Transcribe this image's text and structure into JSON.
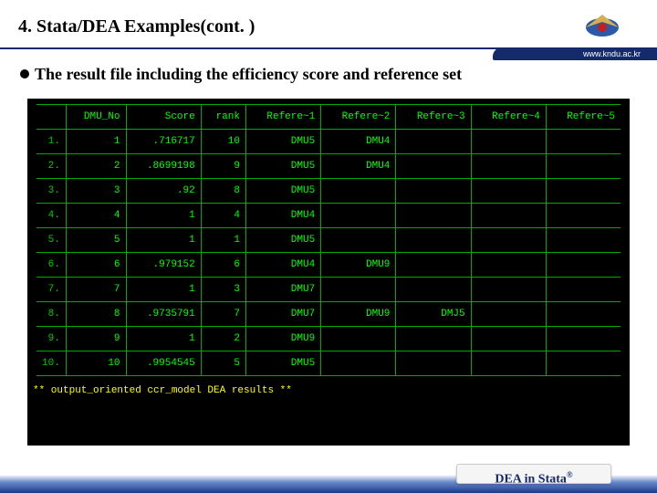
{
  "header": {
    "title": "4. Stata/DEA Examples(cont. )",
    "url": "www.kndu.ac.kr"
  },
  "bullet": "The result file including the efficiency score and reference set",
  "table": {
    "headers": [
      "",
      "DMU_No",
      "Score",
      "rank",
      "Refere~1",
      "Refere~2",
      "Refere~3",
      "Refere~4",
      "Refere~5"
    ],
    "rows": [
      [
        "1.",
        "1",
        ".716717",
        "10",
        "DMU5",
        "DMU4",
        "",
        "",
        ""
      ],
      [
        "2.",
        "2",
        ".8699198",
        "9",
        "DMU5",
        "DMU4",
        "",
        "",
        ""
      ],
      [
        "3.",
        "3",
        ".92",
        "8",
        "DMU5",
        "",
        "",
        "",
        ""
      ],
      [
        "4.",
        "4",
        "1",
        "4",
        "DMU4",
        "",
        "",
        "",
        ""
      ],
      [
        "5.",
        "5",
        "1",
        "1",
        "DMU5",
        "",
        "",
        "",
        ""
      ],
      [
        "6.",
        "6",
        ".979152",
        "6",
        "DMU4",
        "DMU9",
        "",
        "",
        ""
      ],
      [
        "7.",
        "7",
        "1",
        "3",
        "DMU7",
        "",
        "",
        "",
        ""
      ],
      [
        "8.",
        "8",
        ".9735791",
        "7",
        "DMU7",
        "DMU9",
        "DMJ5",
        "",
        ""
      ],
      [
        "9.",
        "9",
        "1",
        "2",
        "DMU9",
        "",
        "",
        "",
        ""
      ],
      [
        "10.",
        "10",
        ".9954545",
        "5",
        "DMU5",
        "",
        "",
        "",
        ""
      ]
    ],
    "message": "** output_oriented ccr_model DEA results **"
  },
  "footer": {
    "label_prefix": "DEA in Stata",
    "reg": "®"
  },
  "chart_data": {
    "type": "table",
    "title": "DEA result file: efficiency score and reference set",
    "columns": [
      "DMU_No",
      "Score",
      "rank",
      "Refere~1",
      "Refere~2",
      "Refere~3",
      "Refere~4",
      "Refere~5"
    ],
    "rows": [
      [
        1,
        0.716717,
        10,
        "DMU5",
        "DMU4",
        null,
        null,
        null
      ],
      [
        2,
        0.8699198,
        9,
        "DMU5",
        "DMU4",
        null,
        null,
        null
      ],
      [
        3,
        0.92,
        8,
        "DMU5",
        null,
        null,
        null,
        null
      ],
      [
        4,
        1,
        4,
        "DMU4",
        null,
        null,
        null,
        null
      ],
      [
        5,
        1,
        1,
        "DMU5",
        null,
        null,
        null,
        null
      ],
      [
        6,
        0.979152,
        6,
        "DMU4",
        "DMU9",
        null,
        null,
        null
      ],
      [
        7,
        1,
        3,
        "DMU7",
        null,
        null,
        null,
        null
      ],
      [
        8,
        0.9735791,
        7,
        "DMU7",
        "DMU9",
        "DMJ5",
        null,
        null
      ],
      [
        9,
        1,
        2,
        "DMU9",
        null,
        null,
        null,
        null
      ],
      [
        10,
        0.9954545,
        5,
        "DMU5",
        null,
        null,
        null,
        null
      ]
    ]
  }
}
